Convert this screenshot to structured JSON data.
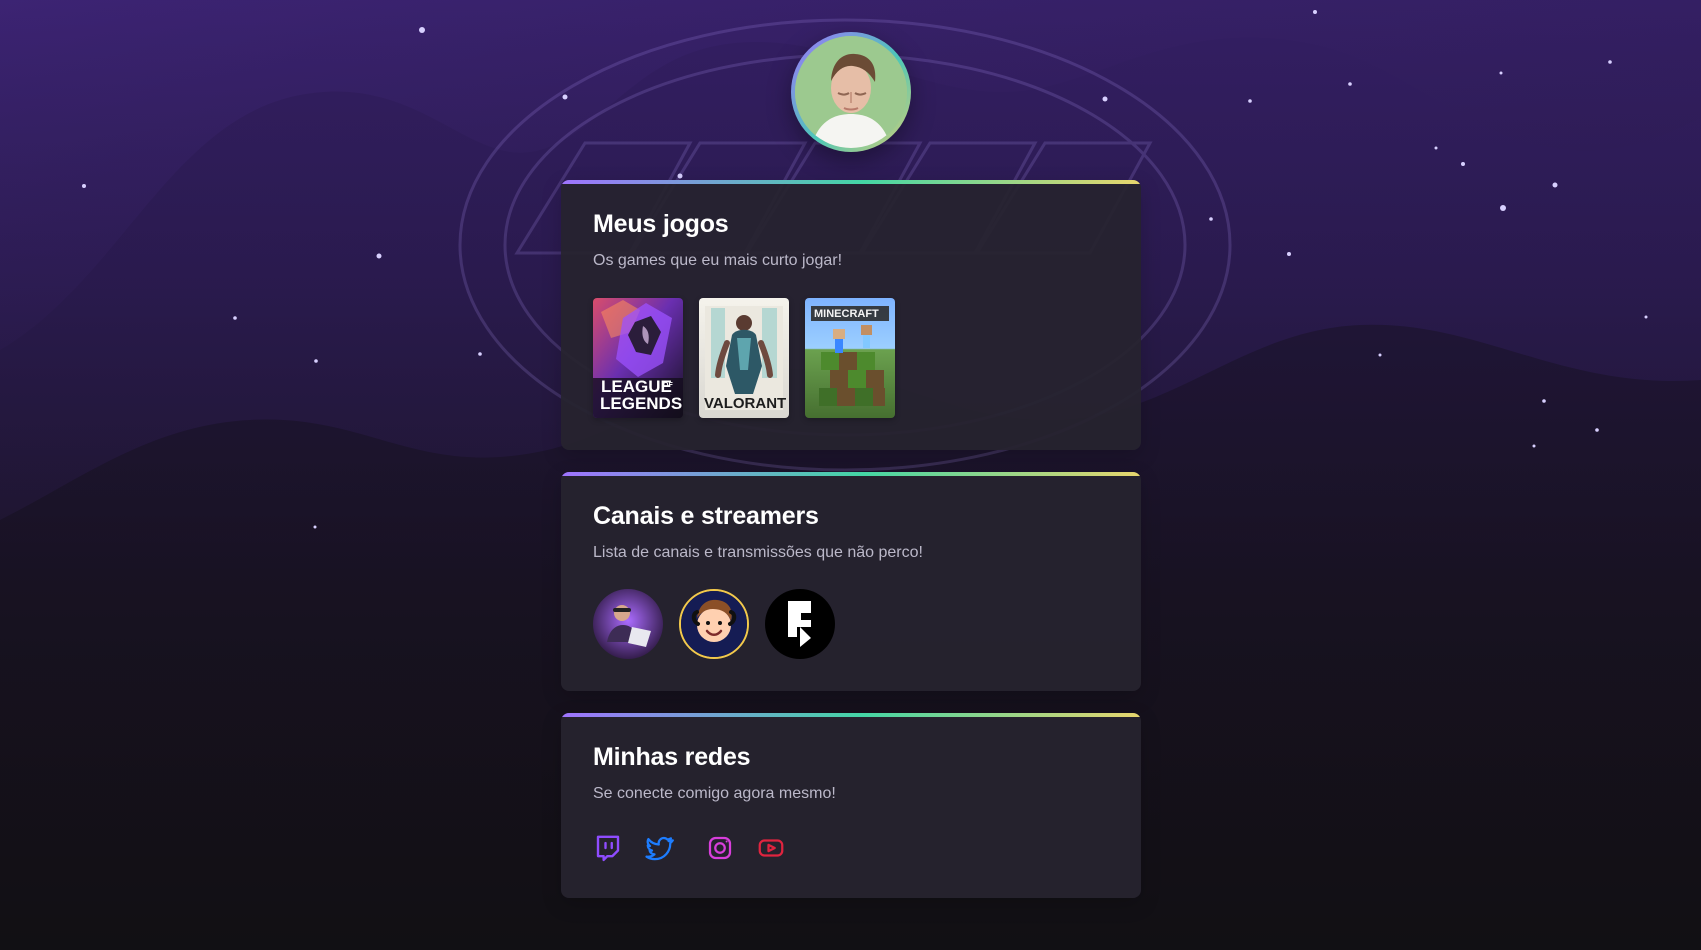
{
  "page": {
    "sections": [
      {
        "title": "Meus jogos",
        "subtitle": "Os games que eu mais curto jogar!",
        "items": [
          {
            "name": "League of Legends",
            "label_line1": "LEAGUE",
            "label_line2": "LEGENDS",
            "label_small": "OF"
          },
          {
            "name": "Valorant",
            "label": "VALORANT"
          },
          {
            "name": "Minecraft",
            "label": "MINECRAFT"
          }
        ]
      },
      {
        "title": "Canais e streamers",
        "subtitle": "Lista de canais e transmissões que não perco!"
      },
      {
        "title": "Minhas redes",
        "subtitle": "Se conecte comigo agora mesmo!",
        "icons": [
          "twitch-icon",
          "twitter-icon",
          "instagram-icon",
          "youtube-icon"
        ]
      }
    ]
  },
  "colors": {
    "background_top": "#2f1c5c",
    "background_bottom": "#121114",
    "card_bg": "#26232f",
    "accent_purple": "#9f73ff",
    "accent_green": "#44d6a5",
    "accent_yellow": "#e8d66d",
    "twitch": "#8f4cff",
    "twitter": "#1d7dff",
    "instagram": "#d83edb",
    "youtube": "#e0243f"
  }
}
